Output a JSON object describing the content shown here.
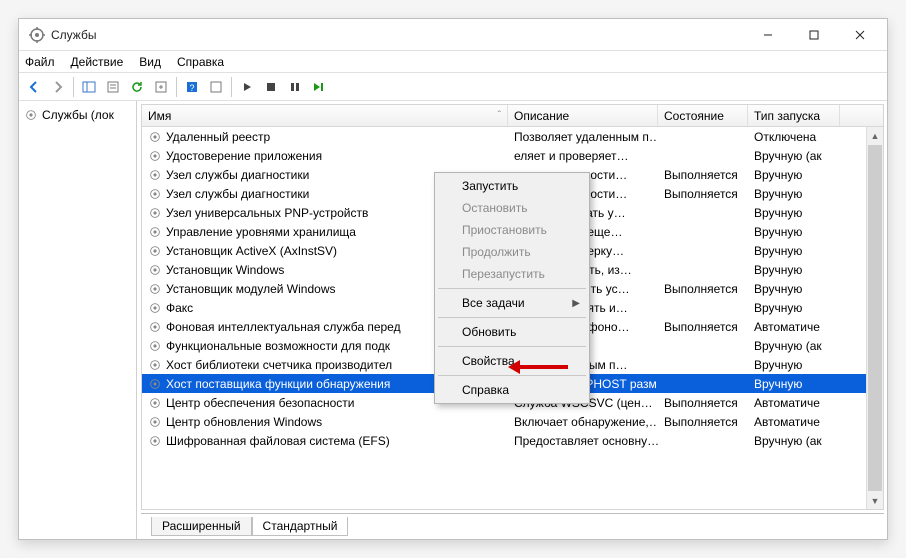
{
  "window": {
    "title": "Службы"
  },
  "menu": {
    "file": "Файл",
    "action": "Действие",
    "view": "Вид",
    "help": "Справка"
  },
  "sidebar": {
    "root": "Службы (лок"
  },
  "columns": {
    "name": "Имя",
    "desc": "Описание",
    "state": "Состояние",
    "startup": "Тип запуска"
  },
  "widths": {
    "name": 366,
    "desc": 150,
    "state": 90,
    "startup": 92
  },
  "rows": [
    {
      "name": "Удаленный реестр",
      "desc": "Позволяет удаленным п…",
      "state": "",
      "startup": "Отключена"
    },
    {
      "name": "Удостоверение приложения",
      "desc": "еляет и проверяет…",
      "state": "",
      "startup": "Вручную (ак"
    },
    {
      "name": "Узел службы диагностики",
      "desc": "истемы диагности…",
      "state": "Выполняется",
      "startup": "Вручную"
    },
    {
      "name": "Узел службы диагностики",
      "desc": "истемы диагности…",
      "state": "Выполняется",
      "startup": "Вручную"
    },
    {
      "name": "Узел универсальных PNP-устройств",
      "desc": "ляет размещать у…",
      "state": "",
      "startup": "Вручную"
    },
    {
      "name": "Управление уровнями хранилища",
      "desc": "изирует размеще…",
      "state": "",
      "startup": "Вручную"
    },
    {
      "name": "Установщик ActiveX (AxInstSV)",
      "desc": "ечивает проверку…",
      "state": "",
      "startup": "Вручную"
    },
    {
      "name": "Установщик Windows",
      "desc": "ляет добавлять, из…",
      "state": "",
      "startup": "Вручную"
    },
    {
      "name": "Установщик модулей Windows",
      "desc": "ляет выполнять ус…",
      "state": "Выполняется",
      "startup": "Вручную"
    },
    {
      "name": "Факс",
      "desc": "ляет отправлять и…",
      "state": "",
      "startup": "Вручную"
    },
    {
      "name": "Фоновая интеллектуальная служба перед",
      "desc": "ает файлы в фоно…",
      "state": "Выполняется",
      "startup": "Автоматиче"
    },
    {
      "name": "Функциональные возможности для подк",
      "desc": "",
      "state": "",
      "startup": "Вручную (ак"
    },
    {
      "name": "Хост библиотеки счетчика производител",
      "desc": "ляет удаленным п…",
      "state": "",
      "startup": "Вручную"
    },
    {
      "name": "Хост поставщика функции обнаружения",
      "desc": "В службе FDPHOST разм…",
      "state": "",
      "startup": "Вручную",
      "selected": true
    },
    {
      "name": "Центр обеспечения безопасности",
      "desc": "Служба WSCSVC (цен…",
      "state": "Выполняется",
      "startup": "Автоматиче"
    },
    {
      "name": "Центр обновления Windows",
      "desc": "Включает обнаружение,…",
      "state": "Выполняется",
      "startup": "Автоматиче"
    },
    {
      "name": "Шифрованная файловая система (EFS)",
      "desc": "Предоставляет основну…",
      "state": "",
      "startup": "Вручную (ак"
    }
  ],
  "tabs": {
    "extended": "Расширенный",
    "standard": "Стандартный"
  },
  "context": {
    "start": "Запустить",
    "stop": "Остановить",
    "pause": "Приостановить",
    "resume": "Продолжить",
    "restart": "Перезапустить",
    "alltasks": "Все задачи",
    "refresh": "Обновить",
    "properties": "Свойства",
    "help": "Справка"
  }
}
